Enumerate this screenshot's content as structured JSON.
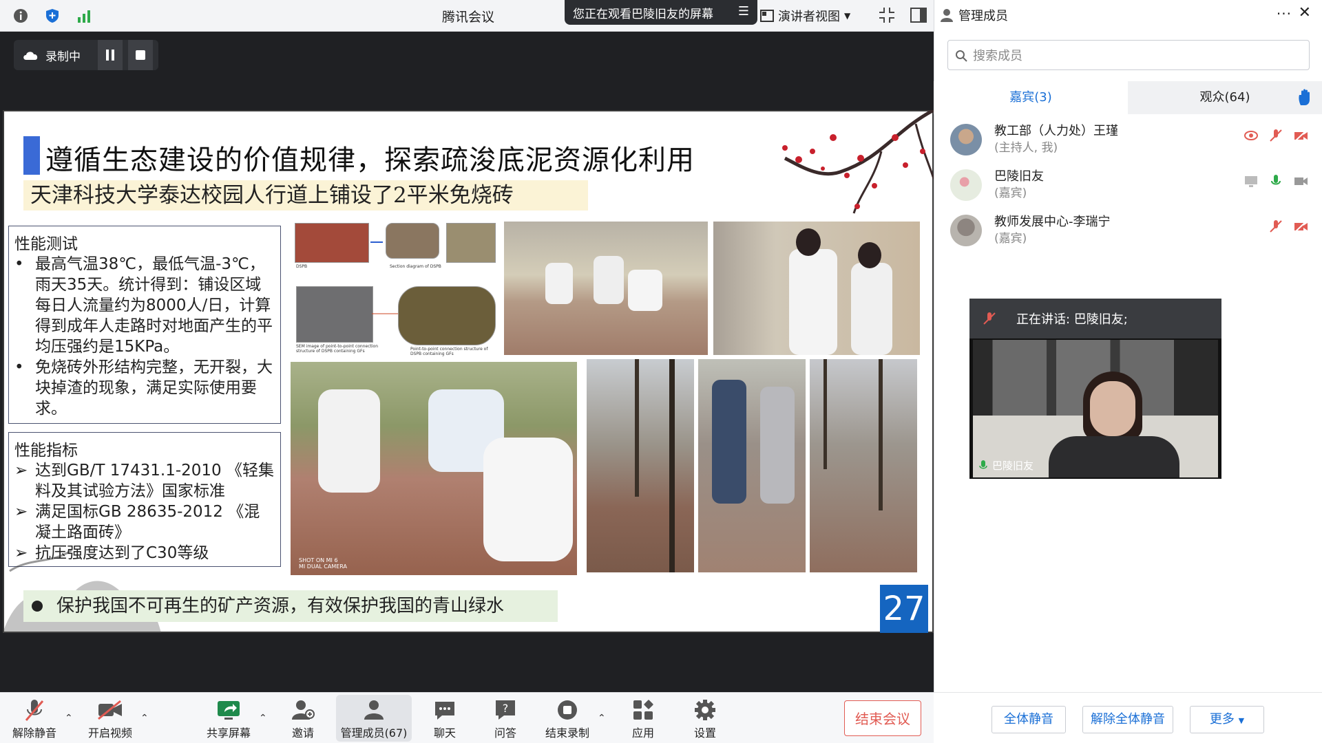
{
  "app": {
    "title": "腾讯会议"
  },
  "banner": {
    "viewing": "您正在观看巴陵旧友的屏幕"
  },
  "view_select": {
    "label": "演讲者视图"
  },
  "recording": {
    "label": "录制中"
  },
  "slide": {
    "title": "遵循生态建设的价值规律，探索疏浚底泥资源化利用",
    "subtitle": "天津科技大学泰达校园人行道上铺设了2平米免烧砖",
    "perf_test": {
      "title": "性能测试",
      "bullets": [
        "最高气温38℃，最低气温-3℃，雨天35天。统计得到：铺设区域每日人流量约为8000人/日，计算得到成年人走路时对地面产生的平均压强约是15KPa。",
        "免烧砖外形结构完整，无开裂，大块掉渣的现象，满足实际使用要求。"
      ]
    },
    "perf_index": {
      "title": "性能指标",
      "bullets": [
        "达到GB/T 17431.1-2010 《轻集料及其试验方法》国家标准",
        "满足国标GB 28635-2012 《混凝土路面砖》",
        "抗压强度达到了C30等级"
      ]
    },
    "diagram_labels": [
      "DSPB",
      "Section diagram of DSPB",
      "SEM image of point-to-point connection structure of DSPB containing GFs",
      "Point-to-point connection structure of DSPB containing GFs"
    ],
    "camera_text": "SHOT ON MI 6\nMI DUAL CAMERA",
    "footer": "保护我国不可再生的矿产资源，有效保护我国的青山绿水",
    "page": "27"
  },
  "sidebar": {
    "title": "管理成员",
    "search_placeholder": "搜索成员",
    "tabs": [
      {
        "label": "嘉宾(3)"
      },
      {
        "label": "观众(64)"
      }
    ],
    "members": [
      {
        "name": "教工部（人力处）王瑾",
        "role": "(主持人, 我)"
      },
      {
        "name": "巴陵旧友",
        "role": "(嘉宾)"
      },
      {
        "name": "教师发展中心-李瑞宁",
        "role": "(嘉宾)"
      }
    ],
    "speaker": {
      "label": "正在讲话: 巴陵旧友;",
      "name": "巴陵旧友"
    },
    "footer_buttons": [
      "全体静音",
      "解除全体静音",
      "更多"
    ]
  },
  "toolbar": {
    "unmute": "解除静音",
    "video": "开启视频",
    "share": "共享屏幕",
    "invite": "邀请",
    "members": "管理成员(67)",
    "chat": "聊天",
    "qa": "问答",
    "stop_rec": "结束录制",
    "apps": "应用",
    "settings": "设置",
    "end": "结束会议"
  },
  "colors": {
    "accent": "#1a6fd6",
    "danger": "#e15b53",
    "slide_page": "#1565c0"
  }
}
